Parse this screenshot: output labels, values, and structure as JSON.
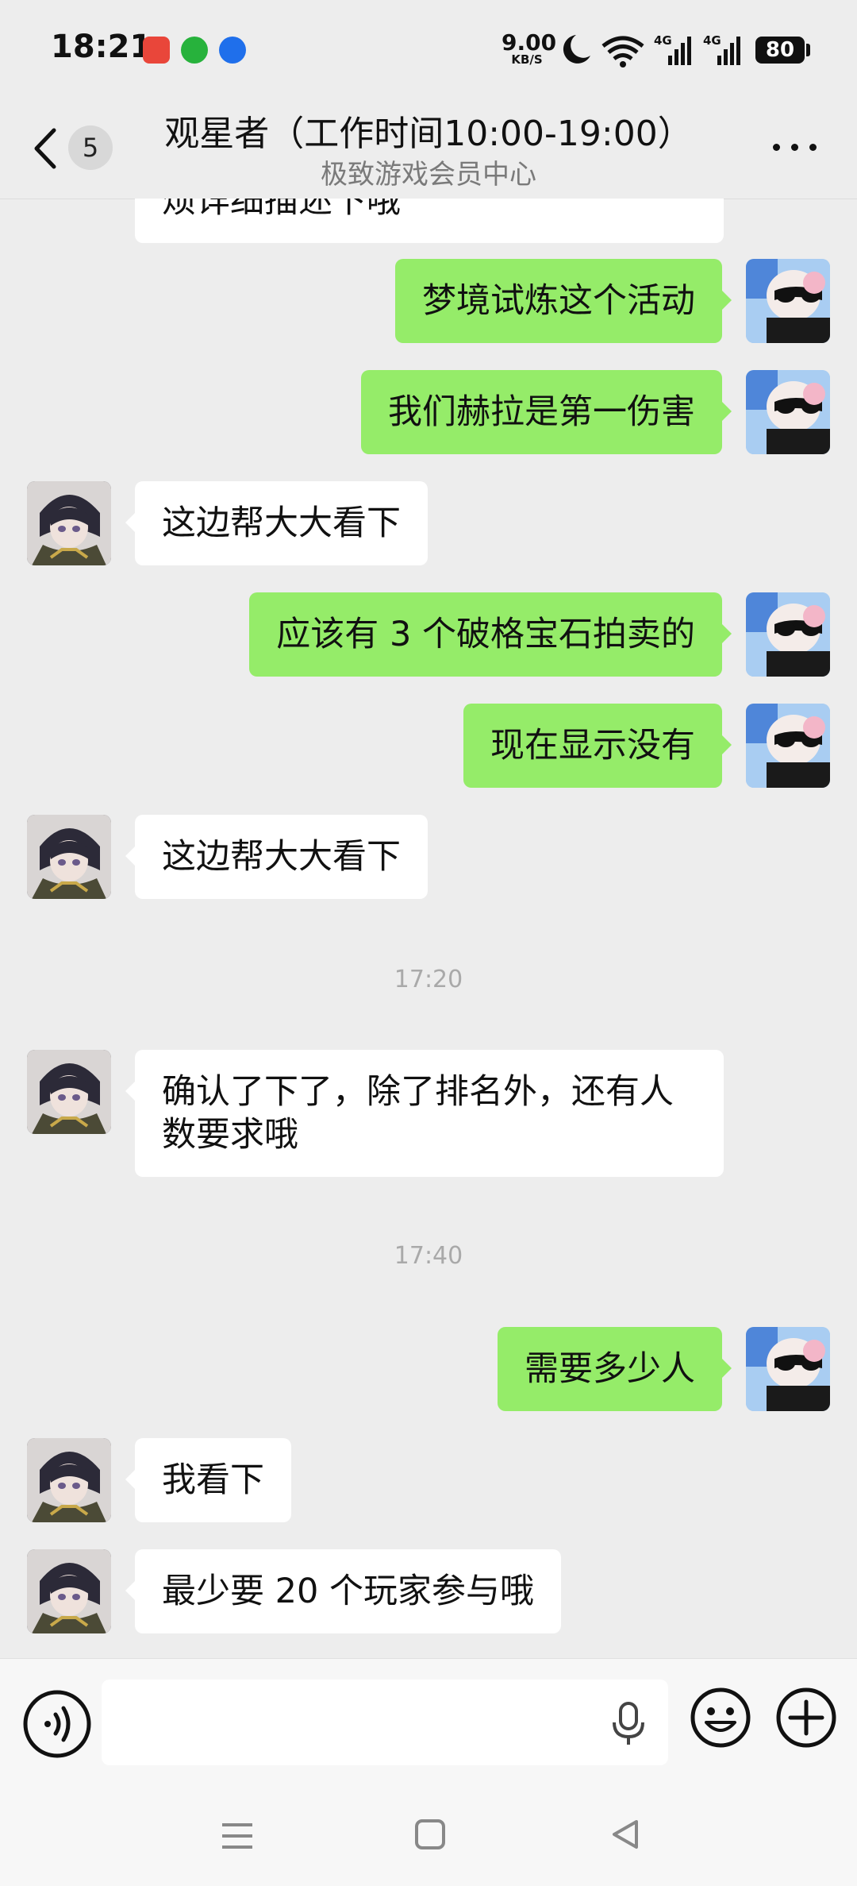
{
  "status_bar": {
    "time": "18:21",
    "net_speed_value": "9.00",
    "net_speed_unit": "KB/S",
    "signal_1_label": "4G",
    "signal_2_label": "4G",
    "battery": "80"
  },
  "header": {
    "unread_count": "5",
    "title": "观星者（工作时间10:00-19:00）",
    "subtitle": "极致游戏会员中心"
  },
  "messages": [
    {
      "from": "agent",
      "text": "烦详细描述下哦"
    },
    {
      "from": "user",
      "text": "梦境试炼这个活动"
    },
    {
      "from": "user",
      "text": "我们赫拉是第一伤害"
    },
    {
      "from": "agent",
      "text": "这边帮大大看下"
    },
    {
      "from": "user",
      "text": "应该有 3 个破格宝石拍卖的"
    },
    {
      "from": "user",
      "text": "现在显示没有"
    },
    {
      "from": "agent",
      "text": "这边帮大大看下"
    },
    {
      "timestamp": "17:20"
    },
    {
      "from": "agent",
      "text": "确认了下了，除了排名外，还有人数要求哦"
    },
    {
      "timestamp": "17:40"
    },
    {
      "from": "user",
      "text": "需要多少人"
    },
    {
      "from": "agent",
      "text": "我看下"
    },
    {
      "from": "agent",
      "text": "最少要 20 个玩家参与哦"
    }
  ],
  "input_bar": {
    "value": "",
    "placeholder": ""
  },
  "icons": {
    "back": "chevron-left-icon",
    "more": "more-horizontal-icon",
    "voice": "voice-mode-icon",
    "mic": "microphone-icon",
    "emoji": "emoji-icon",
    "plus": "plus-icon",
    "nav_menu": "menu-icon",
    "nav_home": "home-square-icon",
    "nav_back": "back-triangle-icon"
  },
  "colors": {
    "background": "#ededed",
    "user_bubble": "#95ec69",
    "agent_bubble": "#ffffff",
    "timestamp": "#a9a9a9"
  }
}
